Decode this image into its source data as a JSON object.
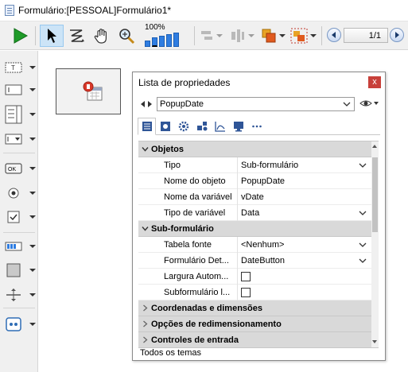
{
  "window": {
    "title": "Formulário:[PESSOAL]Formulário1*"
  },
  "toolbar": {
    "zoom_label": "100%",
    "page_indicator": "1/1",
    "icons": [
      "run-icon",
      "pointer-icon",
      "entry-order-icon",
      "hand-icon",
      "zoom-icon",
      "zoom-level-icon",
      "align-icon",
      "distribute-icon",
      "layer-icon",
      "group-icon",
      "previous-page-icon",
      "next-page-icon"
    ]
  },
  "palette": {
    "icons": [
      "text-tool-icon",
      "input-field-icon",
      "listbox-icon",
      "dropdown-tool-icon",
      "button-tool-icon",
      "radio-button-icon",
      "checkbox-tool-icon",
      "progress-indicator-icon",
      "rectangle-tool-icon",
      "splitter-tool-icon",
      "plugin-area-icon"
    ]
  },
  "canvas": {
    "subform_icon": "subform-calendar-icon"
  },
  "properties": {
    "title": "Lista de propriedades",
    "close_label": "x",
    "object_name": "PopupDate",
    "tabs": [
      "list-tab-icon",
      "display-tab-icon",
      "settings-tab-icon",
      "objects-tab-icon",
      "chart-tab-icon",
      "monitor-tab-icon",
      "more-tab-icon"
    ],
    "groups": {
      "objetos": "Objetos",
      "subform": "Sub-formulário",
      "coords": "Coordenadas e dimensões",
      "resize": "Opções de redimensionamento",
      "entry": "Controles de entrada"
    },
    "rows": {
      "tipo": {
        "name": "Tipo",
        "value": "Sub-formulário"
      },
      "nome_objeto": {
        "name": "Nome do objeto",
        "value": "PopupDate"
      },
      "nome_variavel": {
        "name": "Nome da variável",
        "value": "vDate"
      },
      "tipo_variavel": {
        "name": "Tipo de variável",
        "value": "Data"
      },
      "tabela_fonte": {
        "name": "Tabela fonte",
        "value": "<Nenhum>"
      },
      "formulario_det": {
        "name": "Formulário Det...",
        "value": "DateButton"
      },
      "largura_auto": {
        "name": "Largura Autom...",
        "checked": false
      },
      "subformulario_l": {
        "name": "Subformulário l...",
        "checked": false
      }
    },
    "footer": "Todos os temas"
  }
}
